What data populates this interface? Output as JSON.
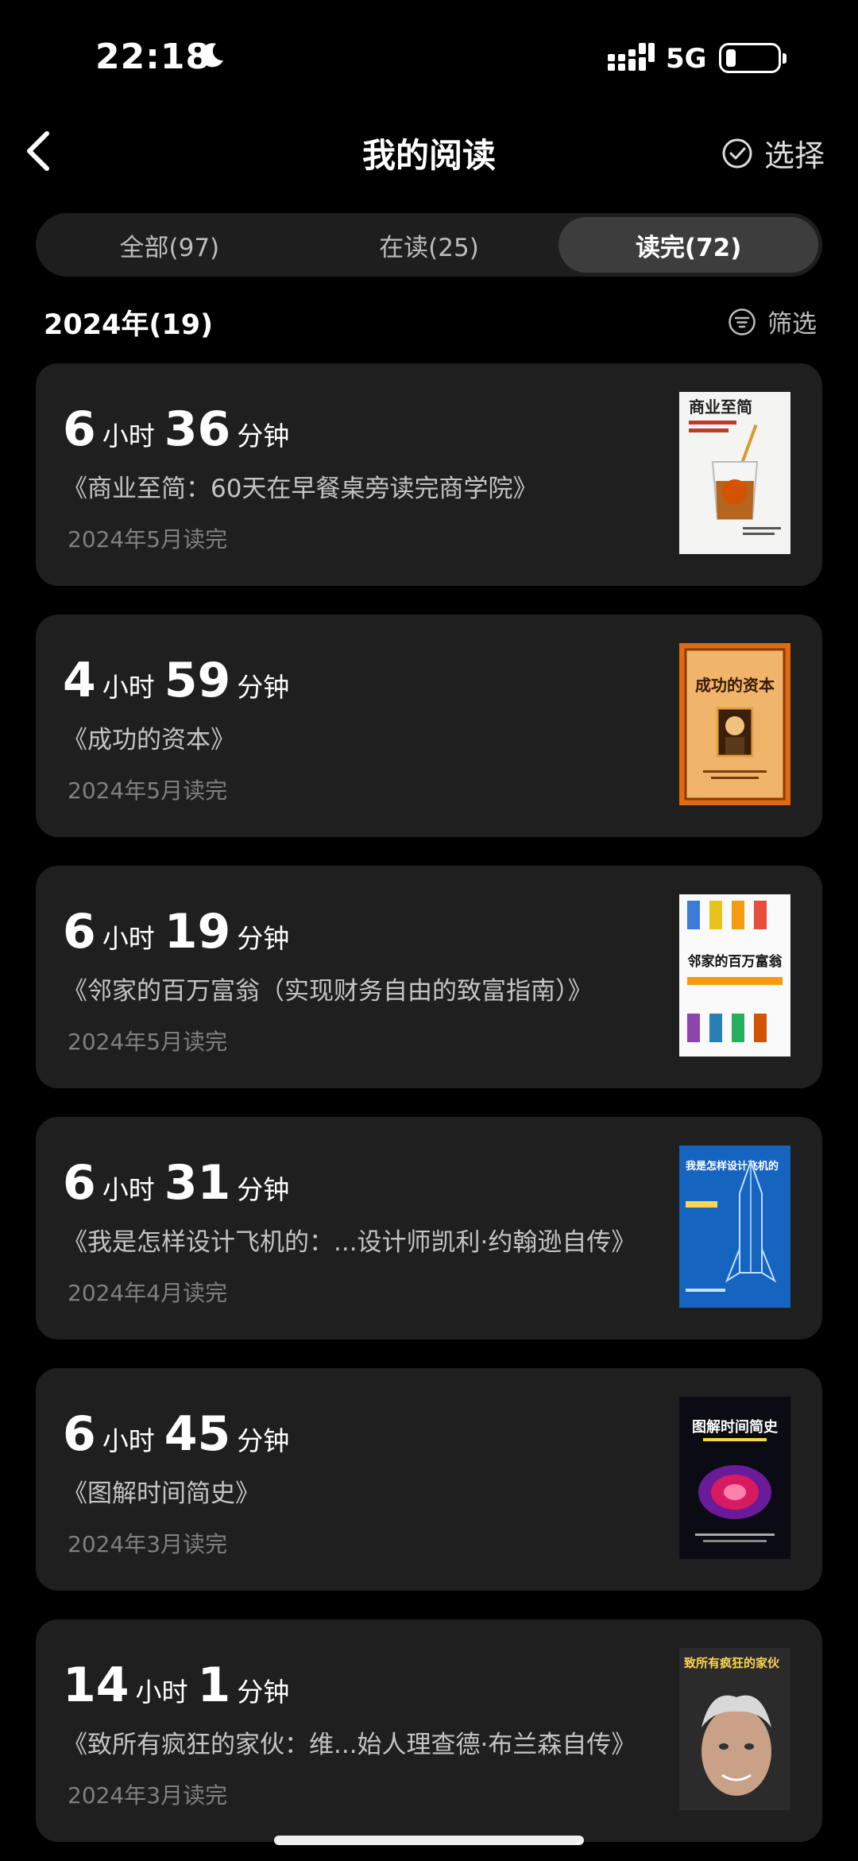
{
  "status_bar": {
    "time": "22:18",
    "network": "5G"
  },
  "header": {
    "title": "我的阅读",
    "select_label": "选择"
  },
  "tabs": [
    {
      "label": "全部(97)",
      "active": false
    },
    {
      "label": "在读(25)",
      "active": false
    },
    {
      "label": "读完(72)",
      "active": true
    }
  ],
  "section": {
    "year_label": "2024年(19)",
    "filter_label": "筛选"
  },
  "books": [
    {
      "hours": "6",
      "minutes": "36",
      "hour_unit": "小时",
      "minute_unit": "分钟",
      "title": "《商业至简：60天在早餐桌旁读完商学院》",
      "date": "2024年5月读完",
      "cover_text": "商业至简"
    },
    {
      "hours": "4",
      "minutes": "59",
      "hour_unit": "小时",
      "minute_unit": "分钟",
      "title": "《成功的资本》",
      "date": "2024年5月读完",
      "cover_text": "成功的资本"
    },
    {
      "hours": "6",
      "minutes": "19",
      "hour_unit": "小时",
      "minute_unit": "分钟",
      "title": "《邻家的百万富翁（实现财务自由的致富指南）》",
      "date": "2024年5月读完",
      "cover_text": "邻家的百万富翁"
    },
    {
      "hours": "6",
      "minutes": "31",
      "hour_unit": "小时",
      "minute_unit": "分钟",
      "title": "《我是怎样设计飞机的：...设计师凯利·约翰逊自传》",
      "date": "2024年4月读完",
      "cover_text": "我是怎样设计飞机的"
    },
    {
      "hours": "6",
      "minutes": "45",
      "hour_unit": "小时",
      "minute_unit": "分钟",
      "title": "《图解时间简史》",
      "date": "2024年3月读完",
      "cover_text": "图解时间简史"
    },
    {
      "hours": "14",
      "minutes": "1",
      "hour_unit": "小时",
      "minute_unit": "分钟",
      "title": "《致所有疯狂的家伙：维...始人理查德·布兰森自传》",
      "date": "2024年3月读完",
      "cover_text": "致所有疯狂的家伙"
    }
  ],
  "colors": {
    "background": "#000000",
    "card": "#1f1f1f",
    "tab_active": "#3d3d3d"
  }
}
